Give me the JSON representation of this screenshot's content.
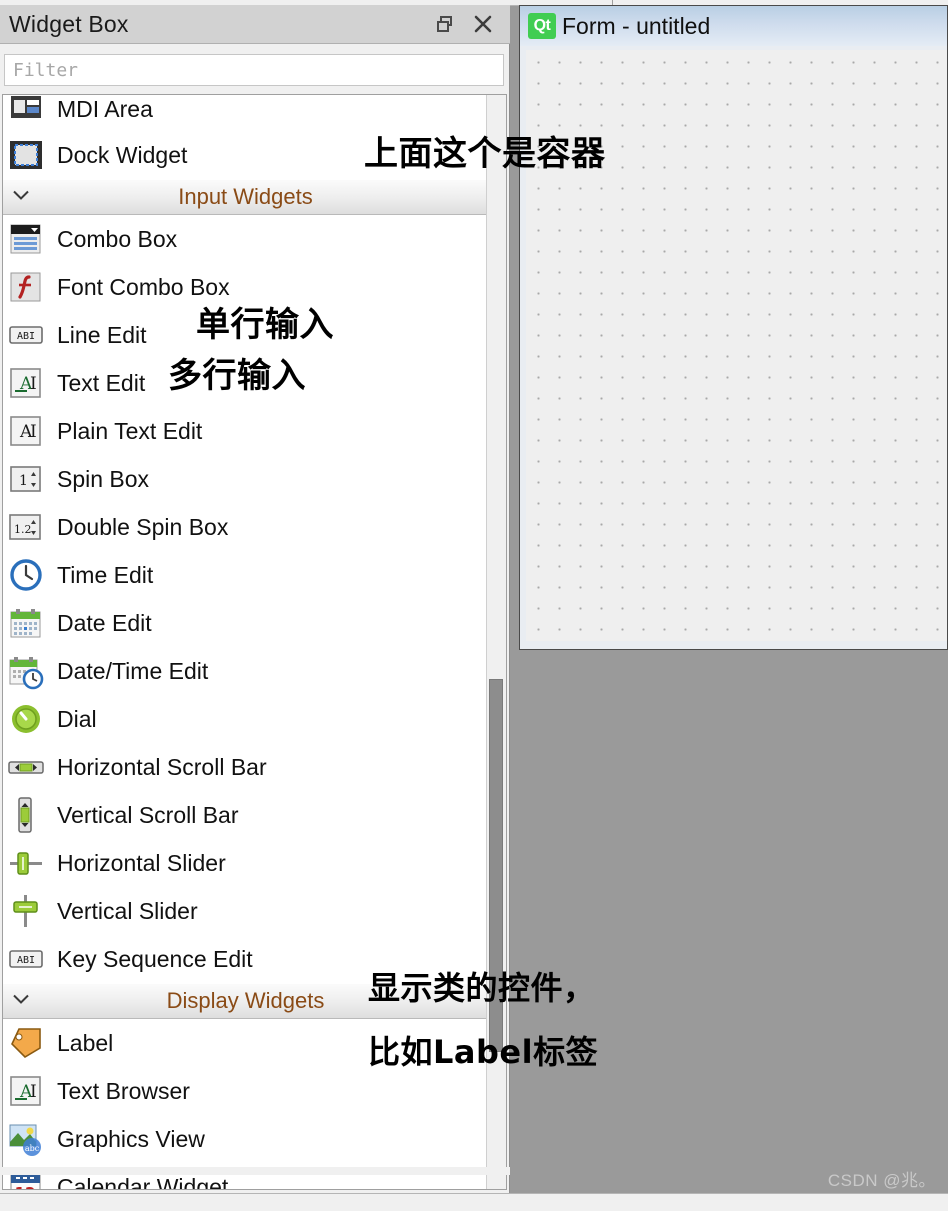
{
  "dock": {
    "title": "Widget Box",
    "float_icon": "float-restore-icon",
    "close_icon": "close-icon",
    "filter": {
      "value": "",
      "placeholder": "Filter"
    }
  },
  "list": {
    "items": [
      {
        "type": "item",
        "label": "MDI Area",
        "icon": "mdi-area-icon"
      },
      {
        "type": "item",
        "label": "Dock Widget",
        "icon": "dock-widget-icon"
      },
      {
        "type": "section",
        "label": "Input Widgets",
        "icon": "chevron-down-icon"
      },
      {
        "type": "item",
        "label": "Combo Box",
        "icon": "combo-box-icon"
      },
      {
        "type": "item",
        "label": "Font Combo Box",
        "icon": "font-combo-box-icon"
      },
      {
        "type": "item",
        "label": "Line Edit",
        "icon": "line-edit-icon"
      },
      {
        "type": "item",
        "label": "Text Edit",
        "icon": "text-edit-icon"
      },
      {
        "type": "item",
        "label": "Plain Text Edit",
        "icon": "plain-text-edit-icon"
      },
      {
        "type": "item",
        "label": "Spin Box",
        "icon": "spin-box-icon"
      },
      {
        "type": "item",
        "label": "Double Spin Box",
        "icon": "double-spin-box-icon"
      },
      {
        "type": "item",
        "label": "Time Edit",
        "icon": "clock-icon"
      },
      {
        "type": "item",
        "label": "Date Edit",
        "icon": "calendar-icon"
      },
      {
        "type": "item",
        "label": "Date/Time Edit",
        "icon": "calendar-clock-icon"
      },
      {
        "type": "item",
        "label": "Dial",
        "icon": "dial-icon"
      },
      {
        "type": "item",
        "label": "Horizontal Scroll Bar",
        "icon": "horizontal-scrollbar-icon"
      },
      {
        "type": "item",
        "label": "Vertical Scroll Bar",
        "icon": "vertical-scrollbar-icon"
      },
      {
        "type": "item",
        "label": "Horizontal Slider",
        "icon": "horizontal-slider-icon"
      },
      {
        "type": "item",
        "label": "Vertical Slider",
        "icon": "vertical-slider-icon"
      },
      {
        "type": "item",
        "label": "Key Sequence Edit",
        "icon": "key-sequence-edit-icon"
      },
      {
        "type": "section",
        "label": "Display Widgets",
        "icon": "chevron-down-icon"
      },
      {
        "type": "item",
        "label": "Label",
        "icon": "label-tag-icon"
      },
      {
        "type": "item",
        "label": "Text Browser",
        "icon": "text-browser-icon"
      },
      {
        "type": "item",
        "label": "Graphics View",
        "icon": "graphics-view-icon"
      },
      {
        "type": "item",
        "label": "Calendar Widget",
        "icon": "calendar-widget-icon"
      }
    ]
  },
  "form_window": {
    "badge": "Qt",
    "title": "Form - untitled"
  },
  "annotations": [
    {
      "text": "上面这个是容器"
    },
    {
      "text": "单行输入"
    },
    {
      "text": "多行输入"
    },
    {
      "text": "显示类的控件，"
    },
    {
      "text": "比如Label标签"
    }
  ],
  "watermark": "CSDN @兆。",
  "colors": {
    "qt_green": "#41cd52",
    "section_text": "#8a4b16",
    "dock_title_bg": "#d2d2d2",
    "workspace_bg": "#9a9a9a",
    "titlebar_blue": "#cfdced"
  }
}
